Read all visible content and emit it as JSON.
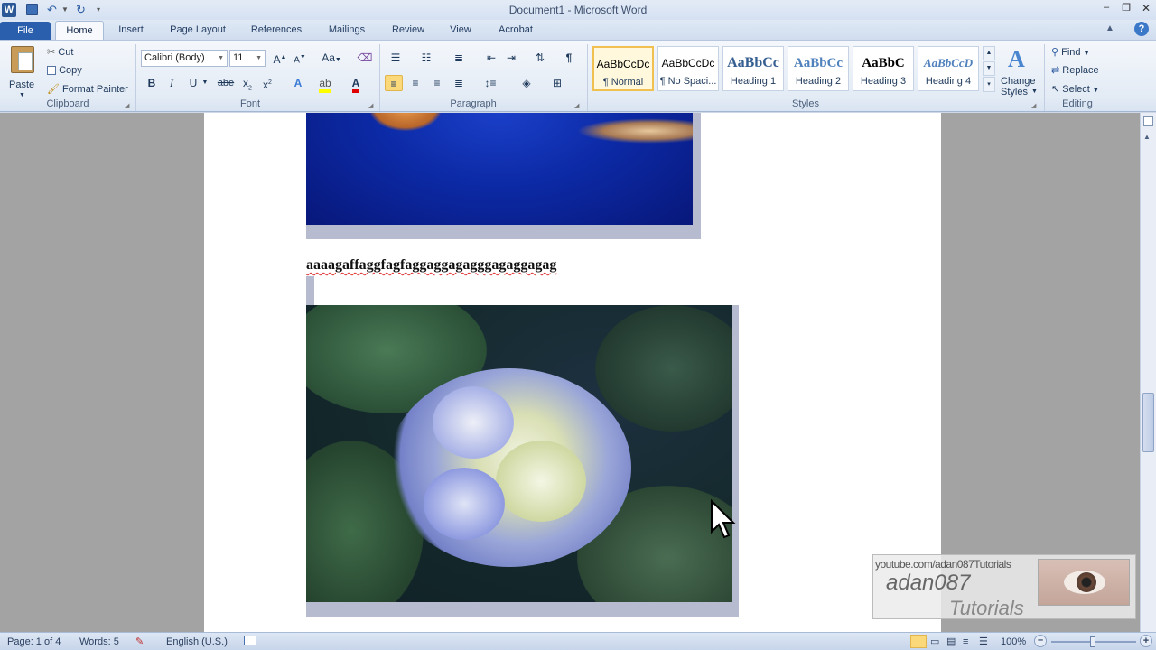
{
  "window": {
    "title": "Document1 - Microsoft Word",
    "app_icon": "W"
  },
  "tabs": [
    "File",
    "Home",
    "Insert",
    "Page Layout",
    "References",
    "Mailings",
    "Review",
    "View",
    "Acrobat"
  ],
  "clipboard": {
    "paste": "Paste",
    "cut": "Cut",
    "copy": "Copy",
    "format_painter": "Format Painter",
    "label": "Clipboard"
  },
  "font": {
    "name": "Calibri (Body)",
    "size": "11",
    "label": "Font"
  },
  "paragraph": {
    "label": "Paragraph"
  },
  "styles": {
    "items": [
      {
        "preview": "AaBbCcDc",
        "name": "¶ Normal"
      },
      {
        "preview": "AaBbCcDc",
        "name": "¶ No Spaci..."
      },
      {
        "preview": "AaBbCc",
        "name": "Heading 1"
      },
      {
        "preview": "AaBbCc",
        "name": "Heading 2"
      },
      {
        "preview": "AaBbC",
        "name": "Heading 3"
      },
      {
        "preview": "AaBbCcD",
        "name": "Heading 4"
      }
    ],
    "change_styles": "Change Styles",
    "change_line1": "Change",
    "change_line2": "Styles",
    "label": "Styles"
  },
  "editing": {
    "find": "Find",
    "replace": "Replace",
    "select": "Select",
    "label": "Editing"
  },
  "document": {
    "heading_text": "aaaagaffaggfagfaggaggagagggagaggagag"
  },
  "watermark": {
    "url": "youtube.com/adan087Tutorials",
    "name": "adan087",
    "subtitle": "Tutorials"
  },
  "status": {
    "page": "Page: 1 of 4",
    "words": "Words: 5",
    "language": "English (U.S.)",
    "zoom": "100%"
  }
}
